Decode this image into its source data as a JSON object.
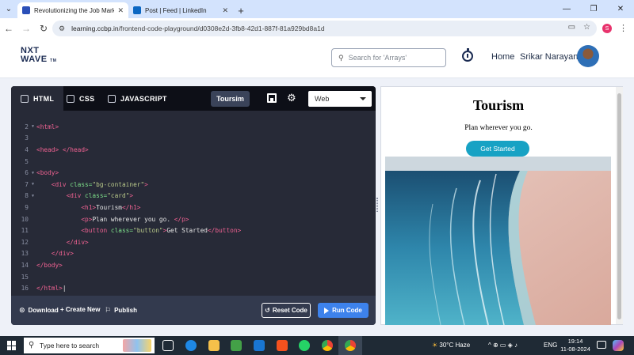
{
  "browser": {
    "tabs": [
      {
        "title": "Revolutionizing the Job Market",
        "active": true,
        "favicon_color": "#2a4fb8"
      },
      {
        "title": "Post | Feed | LinkedIn",
        "active": false,
        "favicon_color": "#0a66c2"
      }
    ],
    "url_host": "learning.ccbp.in",
    "url_path": "/frontend-code-playground/d0308e2d-3fb8-42d1-887f-81a929bd8a1d",
    "profile_initial": "S"
  },
  "site": {
    "logo_line1": "NXT",
    "logo_line2": "WAVE",
    "logo_tm": "TM",
    "search_placeholder": "Search for 'Arrays'",
    "home_label": "Home",
    "user_name": "Srikar Narayan"
  },
  "editor": {
    "tabs": [
      "HTML",
      "CSS",
      "JAVASCRIPT"
    ],
    "project_name": "Toursim",
    "language": "Web",
    "code_lines": [
      {
        "n": "2",
        "fold": true,
        "html": "<span class=\"tag\">&lt;html&gt;</span>"
      },
      {
        "n": "3",
        "fold": false,
        "html": ""
      },
      {
        "n": "4",
        "fold": false,
        "html": "<span class=\"tag\">&lt;head&gt;</span> <span class=\"tag\">&lt;/head&gt;</span>"
      },
      {
        "n": "5",
        "fold": false,
        "html": ""
      },
      {
        "n": "6",
        "fold": true,
        "html": "<span class=\"tag\">&lt;body&gt;</span>"
      },
      {
        "n": "7",
        "fold": true,
        "html": "    <span class=\"tag\">&lt;div</span> <span class=\"attr\">class=</span><span class=\"str\">\"bg-container\"</span><span class=\"tag\">&gt;</span>"
      },
      {
        "n": "8",
        "fold": true,
        "html": "        <span class=\"tag\">&lt;div</span> <span class=\"attr\">class=</span><span class=\"str\">\"card\"</span><span class=\"tag\">&gt;</span>"
      },
      {
        "n": "9",
        "fold": false,
        "html": "            <span class=\"tag\">&lt;h1&gt;</span>Tourism<span class=\"tag\">&lt;/h1&gt;</span>"
      },
      {
        "n": "10",
        "fold": false,
        "html": "            <span class=\"tag\">&lt;p&gt;</span>Plan wherever you go. <span class=\"tag\">&lt;/p&gt;</span>"
      },
      {
        "n": "11",
        "fold": false,
        "html": "            <span class=\"tag\">&lt;button</span> <span class=\"attr\">class=</span><span class=\"str\">\"button\"</span><span class=\"tag\">&gt;</span>Get Started<span class=\"tag\">&lt;/button&gt;</span>"
      },
      {
        "n": "12",
        "fold": false,
        "html": "        <span class=\"tag\">&lt;/div&gt;</span>"
      },
      {
        "n": "13",
        "fold": false,
        "html": "    <span class=\"tag\">&lt;/div&gt;</span>"
      },
      {
        "n": "14",
        "fold": false,
        "html": "<span class=\"tag\">&lt;/body&gt;</span>"
      },
      {
        "n": "15",
        "fold": false,
        "html": ""
      },
      {
        "n": "16",
        "fold": false,
        "html": "<span class=\"tag\">&lt;/html&gt;</span>|"
      }
    ],
    "footer": {
      "download": "Download",
      "create_new": "+ Create New",
      "publish": "Publish",
      "reset": "Reset Code",
      "run": "Run Code"
    }
  },
  "preview": {
    "title": "Tourism",
    "subtitle": "Plan wherever you go.",
    "button": "Get Started",
    "image_icon": "beach-shoreline-image"
  },
  "taskbar": {
    "search_placeholder": "Type here to search",
    "weather": "30°C  Haze",
    "language": "ENG",
    "time": "19:14",
    "date": "11-08-2024"
  },
  "colors": {
    "accent": "#3d82ec",
    "preview_button": "#17a2c4",
    "editor_bg": "#272a37",
    "tag_pink": "#f06292"
  }
}
